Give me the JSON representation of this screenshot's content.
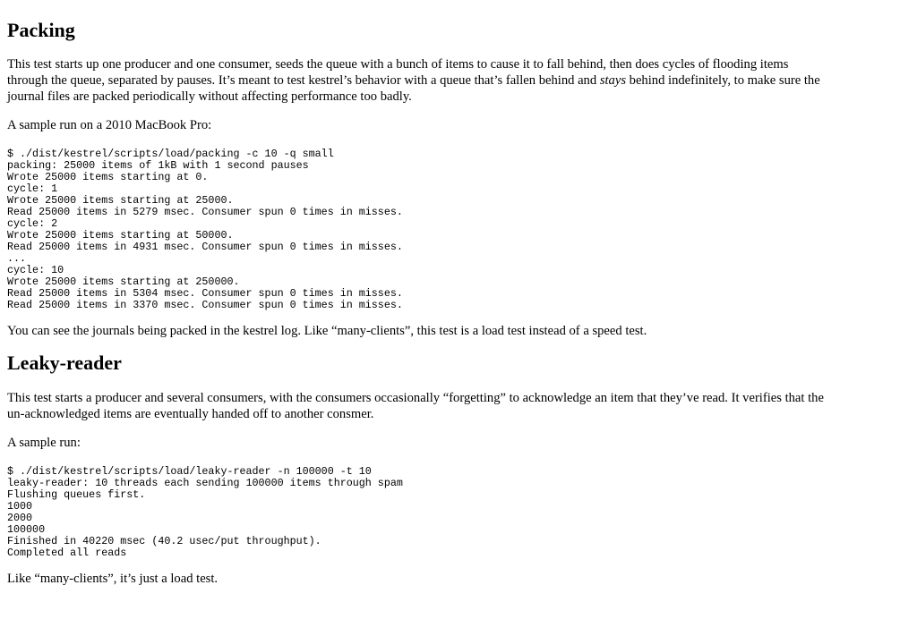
{
  "packing": {
    "heading": "Packing",
    "intro_lines": [
      "This test starts up one producer and one consumer, seeds the queue with a bunch of items to cause it to fall behind, then does cycles of flooding items",
      "through the queue, separated by pauses. It’s meant to test kestrel’s behavior with a queue that’s fallen behind and ",
      "journal files are packed periodically without affecting performance too badly."
    ],
    "intro_emph": "stays",
    "intro_after_emph": " behind indefinitely, to make sure the",
    "sample_label": "A sample run on a 2010 MacBook Pro:",
    "code_lines": [
      "$ ./dist/kestrel/scripts/load/packing -c 10 -q small",
      "packing: 25000 items of 1kB with 1 second pauses",
      "Wrote 25000 items starting at 0.",
      "cycle: 1",
      "Wrote 25000 items starting at 25000.",
      "Read 25000 items in 5279 msec. Consumer spun 0 times in misses.",
      "cycle: 2",
      "Wrote 25000 items starting at 50000.",
      "Read 25000 items in 4931 msec. Consumer spun 0 times in misses.",
      "...",
      "cycle: 10",
      "Wrote 25000 items starting at 250000.",
      "Read 25000 items in 5304 msec. Consumer spun 0 times in misses.",
      "Read 25000 items in 3370 msec. Consumer spun 0 times in misses."
    ],
    "outro": "You can see the journals being packed in the kestrel log. Like “many-clients”, this test is a load test instead of a speed test."
  },
  "leaky": {
    "heading": "Leaky-reader",
    "intro_lines": [
      "This test starts a producer and several consumers, with the consumers occasionally “forgetting” to acknowledge an item that they’ve read. It verifies that the",
      "un-acknowledged items are eventually handed off to another consmer."
    ],
    "sample_label": "A sample run:",
    "code_lines": [
      "$ ./dist/kestrel/scripts/load/leaky-reader -n 100000 -t 10",
      "leaky-reader: 10 threads each sending 100000 items through spam",
      "Flushing queues first.",
      "1000",
      "2000",
      "100000",
      "Finished in 40220 msec (40.2 usec/put throughput).",
      "Completed all reads"
    ],
    "outro": "Like “many-clients”, it’s just a load test."
  }
}
